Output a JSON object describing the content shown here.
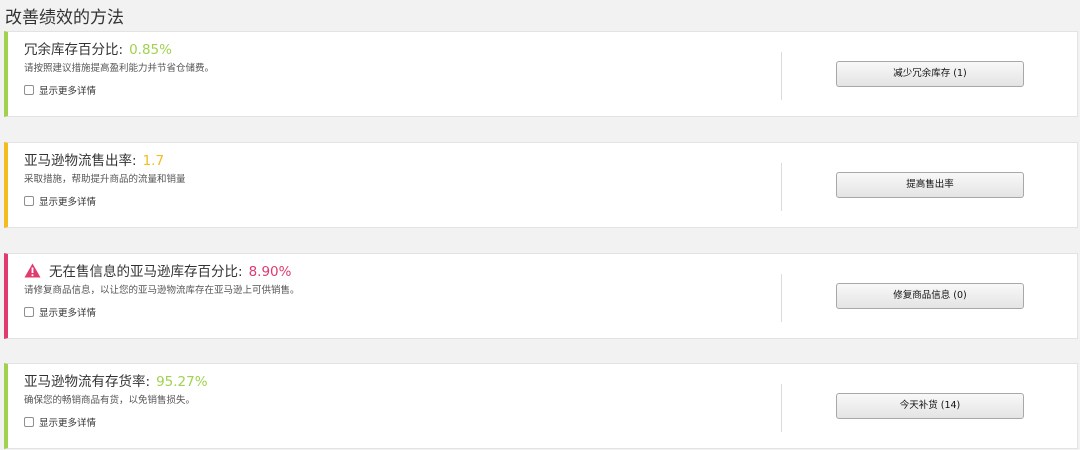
{
  "page_title": "改善绩效的方法",
  "colors": {
    "green": "#a1d24f",
    "yellow": "#f5bc1f",
    "red": "#e03a6e"
  },
  "cards": [
    {
      "title": "冗余库存百分比:",
      "value": "0.85%",
      "status_color": "#a1d24f",
      "description": "请按照建议措施提高盈利能力并节省仓储费。",
      "more_label": "显示更多详情",
      "action_label": "减少冗余库存 (1)",
      "icon": ""
    },
    {
      "title": "亚马逊物流售出率:",
      "value": "1.7",
      "status_color": "#f5bc1f",
      "description": "采取措施，帮助提升商品的流量和销量",
      "more_label": "显示更多详情",
      "action_label": "提高售出率",
      "icon": ""
    },
    {
      "title": "无在售信息的亚马逊库存百分比:",
      "value": "8.90%",
      "status_color": "#e03a6e",
      "description": "请修复商品信息，以让您的亚马逊物流库存在亚马逊上可供销售。",
      "more_label": "显示更多详情",
      "action_label": "修复商品信息 (0)",
      "icon": "warning-icon"
    },
    {
      "title": "亚马逊物流有存货率:",
      "value": "95.27%",
      "status_color": "#a1d24f",
      "description": "确保您的畅销商品有货，以免销售损失。",
      "more_label": "显示更多详情",
      "action_label": "今天补货 (14)",
      "icon": ""
    }
  ]
}
